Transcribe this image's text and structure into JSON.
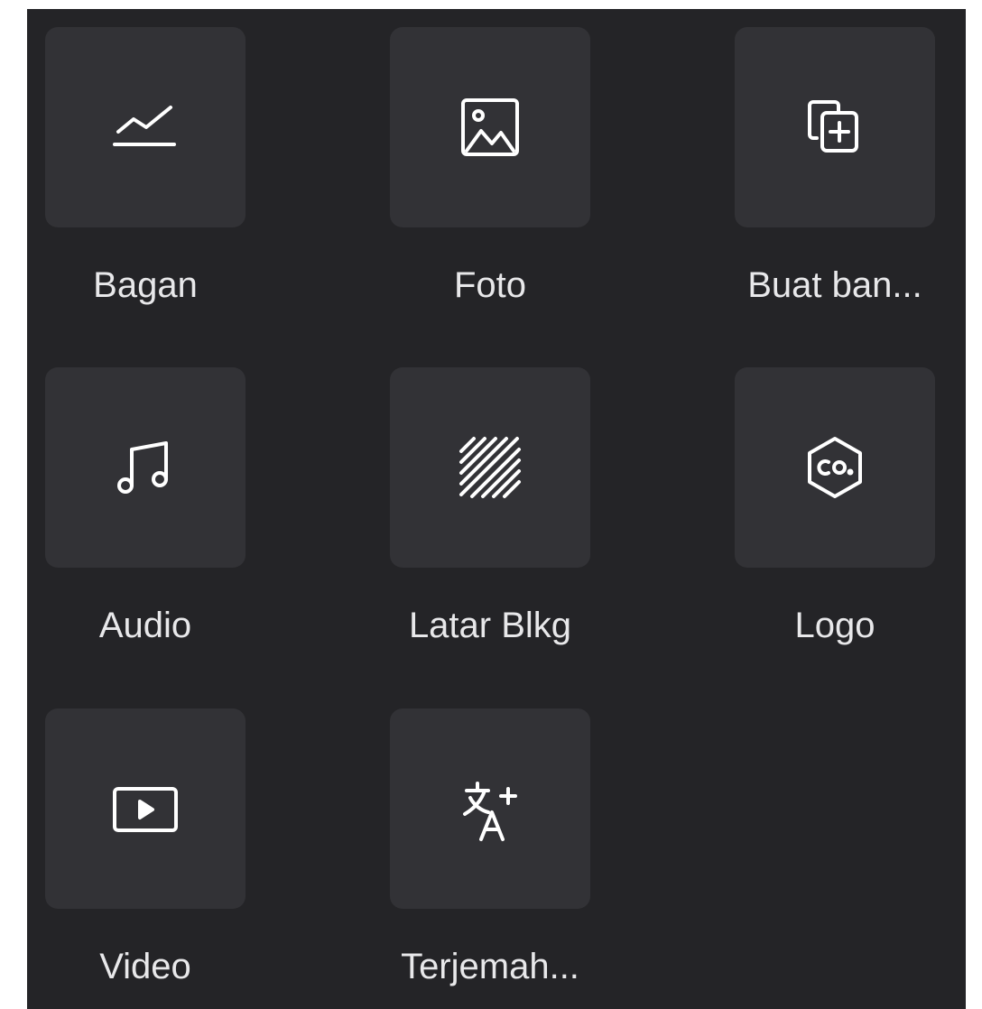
{
  "colors": {
    "panel_background": "#242427",
    "tile_background": "#323236",
    "icon_color": "#ffffff",
    "label_color": "#e8e8ea"
  },
  "tiles": [
    {
      "label": "Bagan",
      "icon": "chart-line-icon"
    },
    {
      "label": "Foto",
      "icon": "image-icon"
    },
    {
      "label": "Buat ban...",
      "icon": "copy-plus-icon"
    },
    {
      "label": "Audio",
      "icon": "music-note-icon"
    },
    {
      "label": "Latar Blkg",
      "icon": "diagonal-pattern-icon"
    },
    {
      "label": "Logo",
      "icon": "logo-hexagon-icon"
    },
    {
      "label": "Video",
      "icon": "video-play-icon"
    },
    {
      "label": "Terjemah...",
      "icon": "translate-icon"
    }
  ]
}
